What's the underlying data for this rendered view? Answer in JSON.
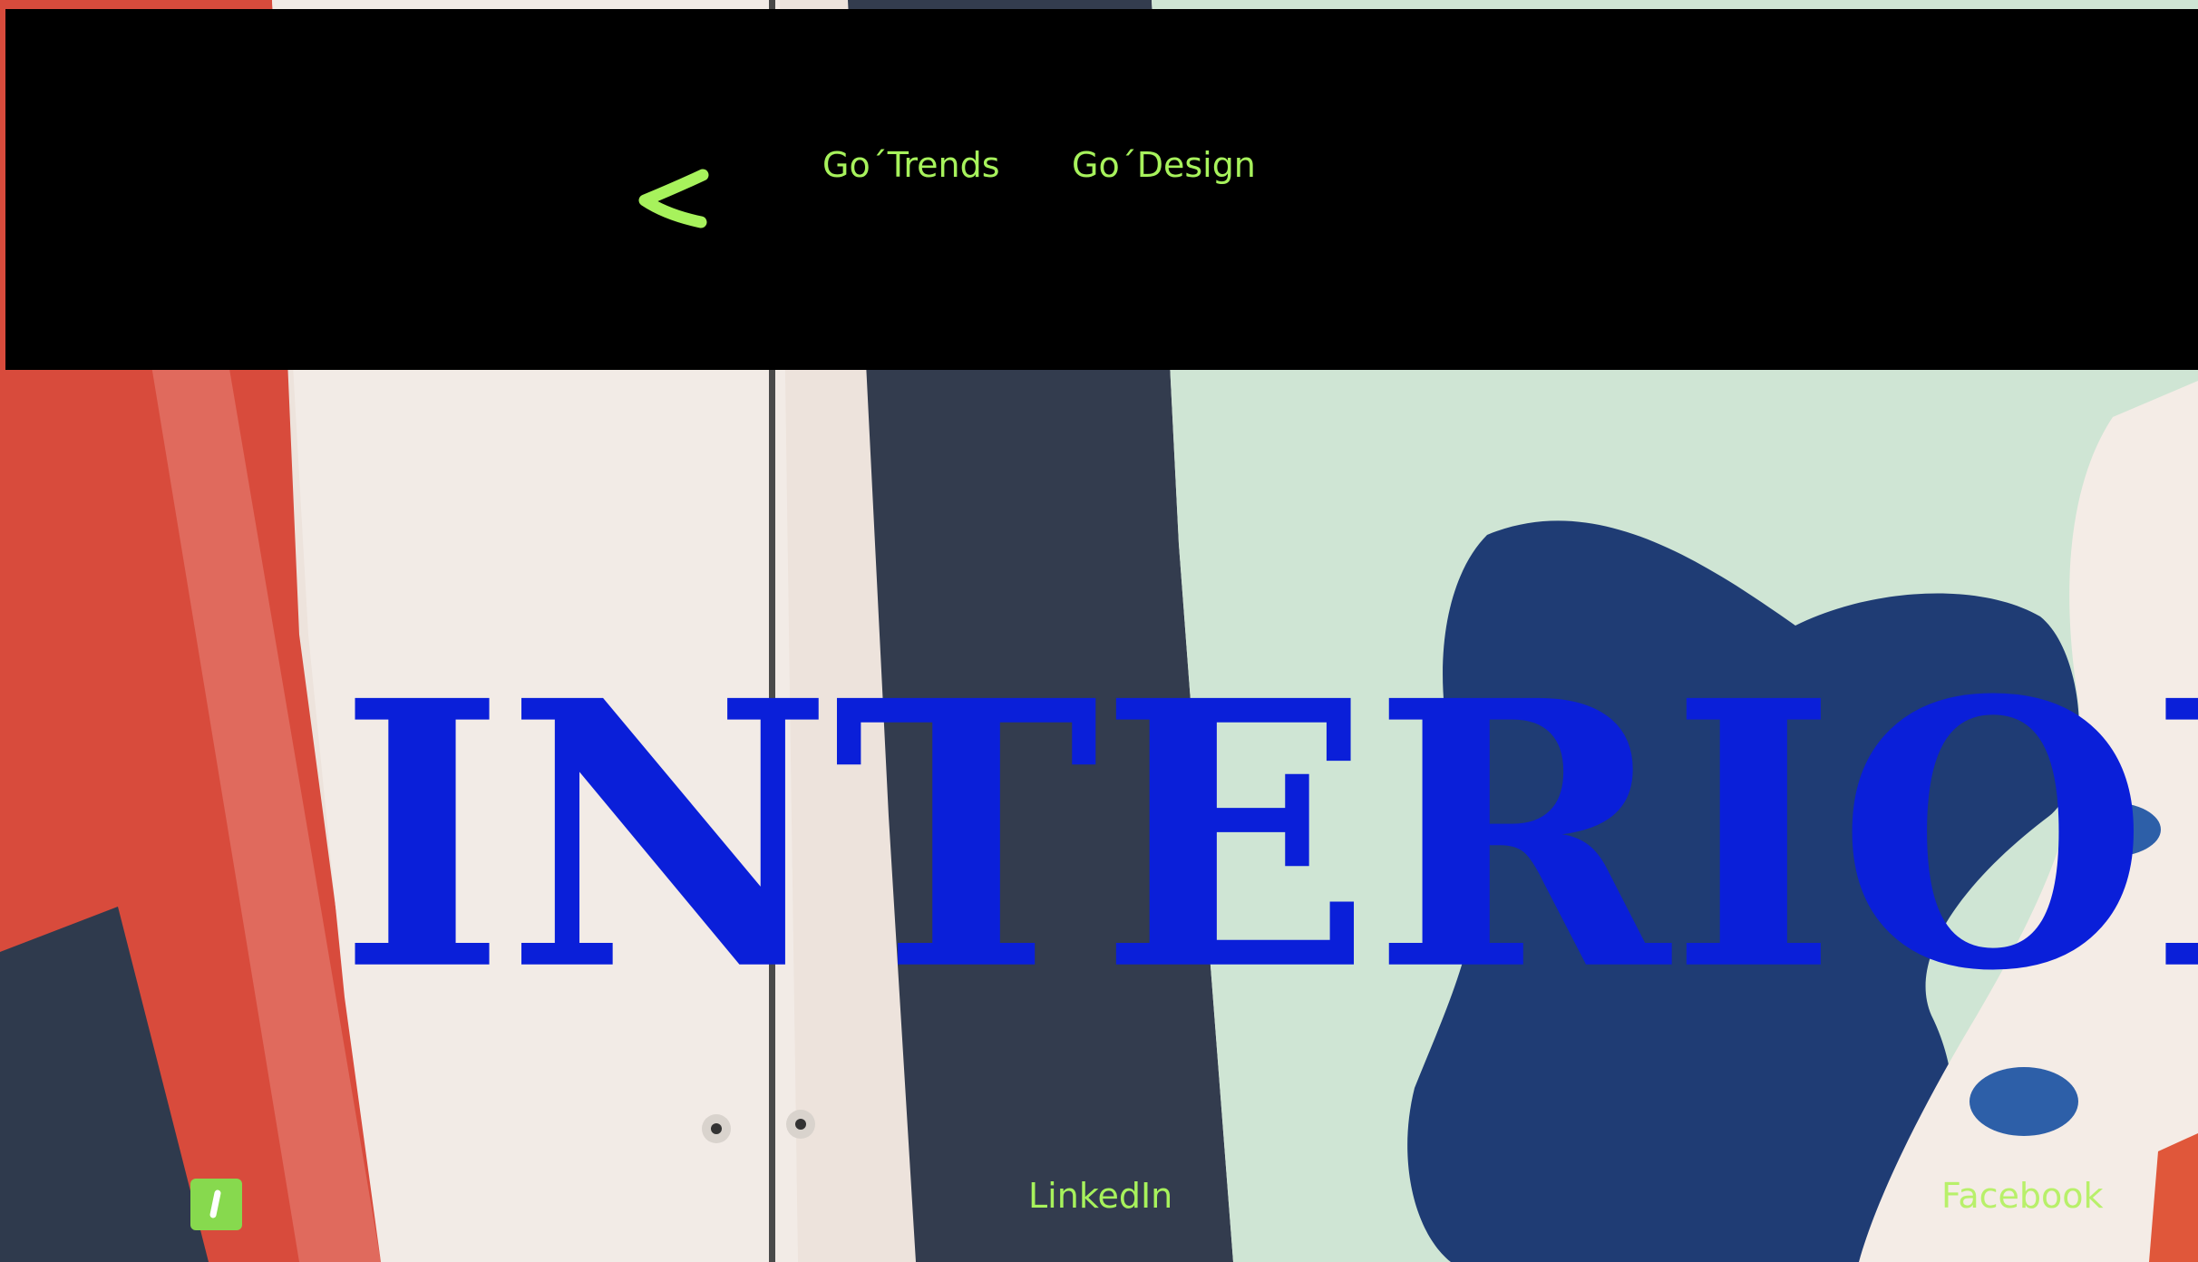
{
  "header": {
    "back_icon": "chevron-left-icon",
    "nav": [
      {
        "label": "Go´Trends"
      },
      {
        "label": "Go´Design"
      }
    ]
  },
  "hero": {
    "title": "INTERIOR"
  },
  "footer": {
    "badge_icon": "brand-badge-icon",
    "links": [
      {
        "label": "LinkedIn"
      },
      {
        "label": "Facebook"
      }
    ]
  },
  "colors": {
    "topbar": "#000000",
    "accent_green": "#a7f25c",
    "hero_blue": "#0a1fd9",
    "badge_green": "#87d94e"
  }
}
